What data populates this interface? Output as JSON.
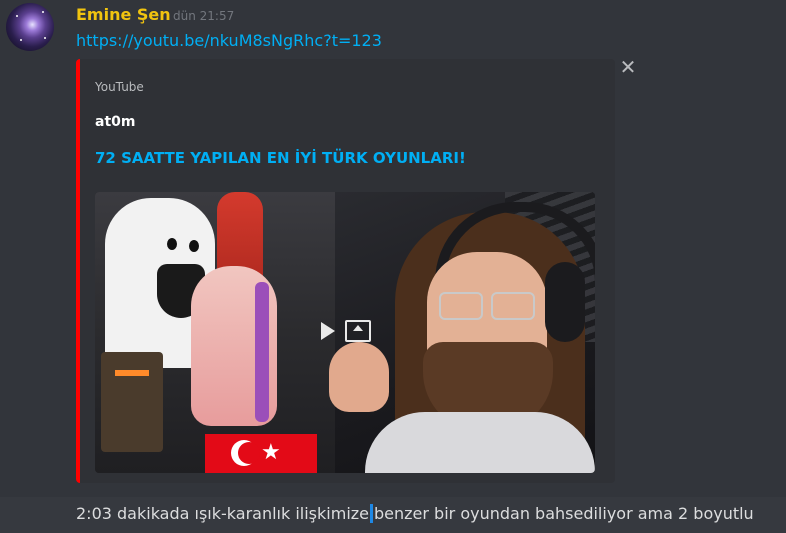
{
  "message": {
    "username": "Emine Şen",
    "timestamp": "dün 21:57",
    "link": "https://youtu.be/nkuM8sNgRhc?t=123"
  },
  "embed": {
    "provider": "YouTube",
    "author": "at0m",
    "title": "72 SAATTE YAPILAN EN İYİ TÜRK OYUNLARI!",
    "accent_color": "#ff0000",
    "thumbnail_icons": [
      "play-icon",
      "open-external-icon"
    ]
  },
  "close_icon": "✕",
  "followup": {
    "text_before": "2:03 dakikada ışık-karanlık ilişkimize",
    "text_after": "benzer bir oyundan bahsediliyor ama 2 boyutlu"
  },
  "colors": {
    "username": "#f1c40f",
    "link": "#00aff4",
    "background": "#36393f",
    "embed_bg": "#2f3136"
  }
}
